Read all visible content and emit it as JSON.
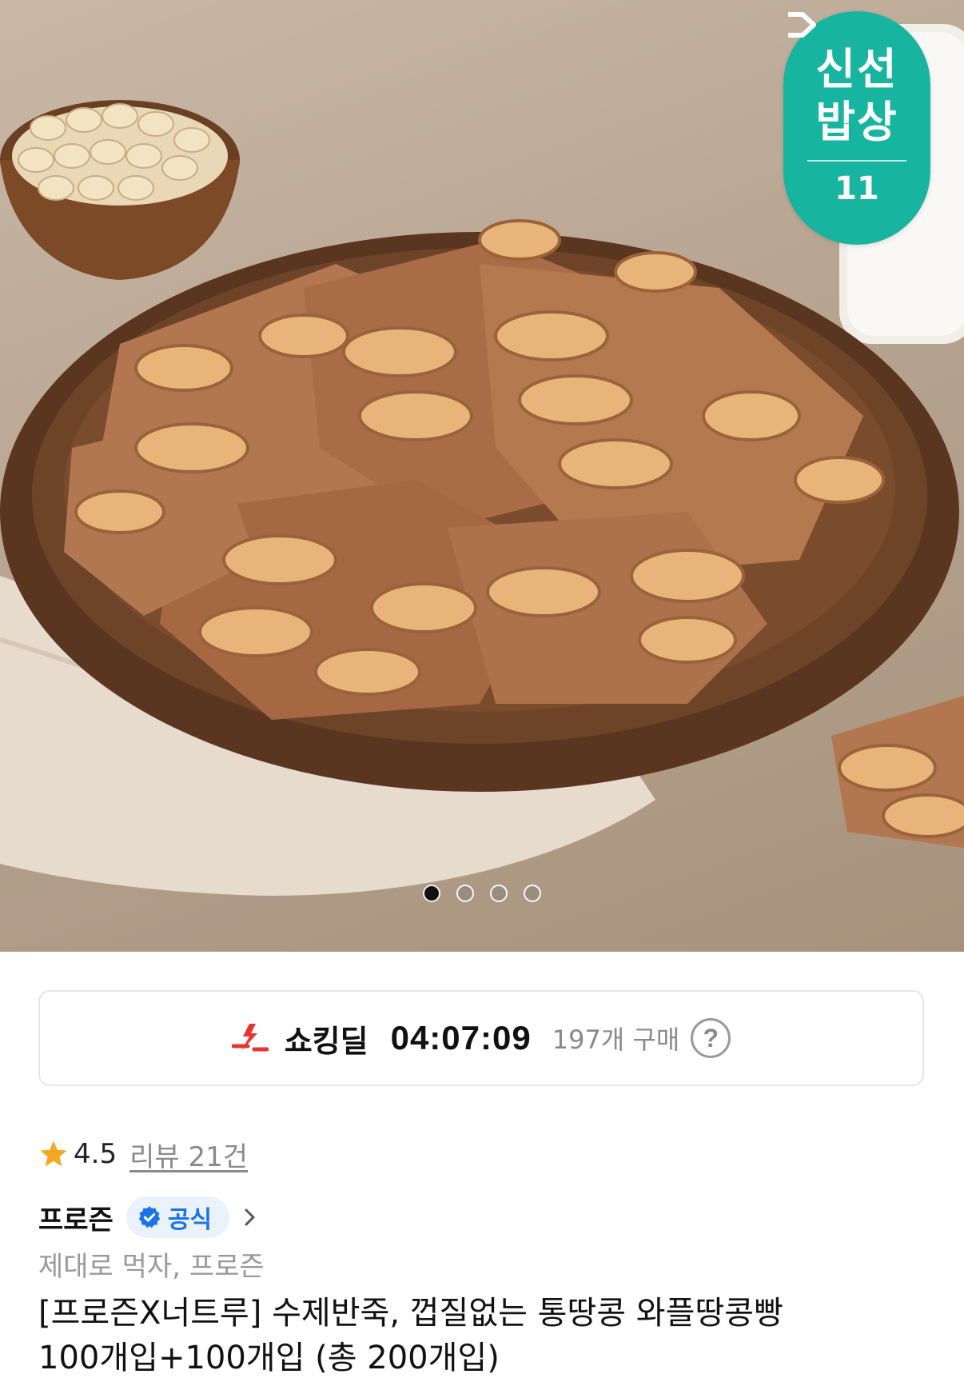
{
  "hero": {
    "badge": {
      "line1": "신선",
      "line2": "밥상",
      "brand": "11"
    },
    "carousel": {
      "current_index": 1,
      "total": 4
    }
  },
  "deal": {
    "label": "쇼킹딜",
    "timer": "04:07:09",
    "purchase_count": "197개 구매",
    "help_glyph": "?"
  },
  "rating": {
    "value": "4.5",
    "review_link": "리뷰 21건"
  },
  "seller": {
    "name": "프로즌",
    "official_label": "공식",
    "tagline": "제대로 먹자, 프로즌"
  },
  "product": {
    "title_line1": "[프로즌X너트루] 수제반죽, 껍질없는 통땅콩 와플땅콩빵",
    "title_line2": "100개입+100개입 (총 200개입)"
  },
  "colors": {
    "badge_teal": "#17b4a0",
    "deal_red": "#e8322f",
    "star": "#f5a623",
    "official_blue": "#1a73e8"
  }
}
